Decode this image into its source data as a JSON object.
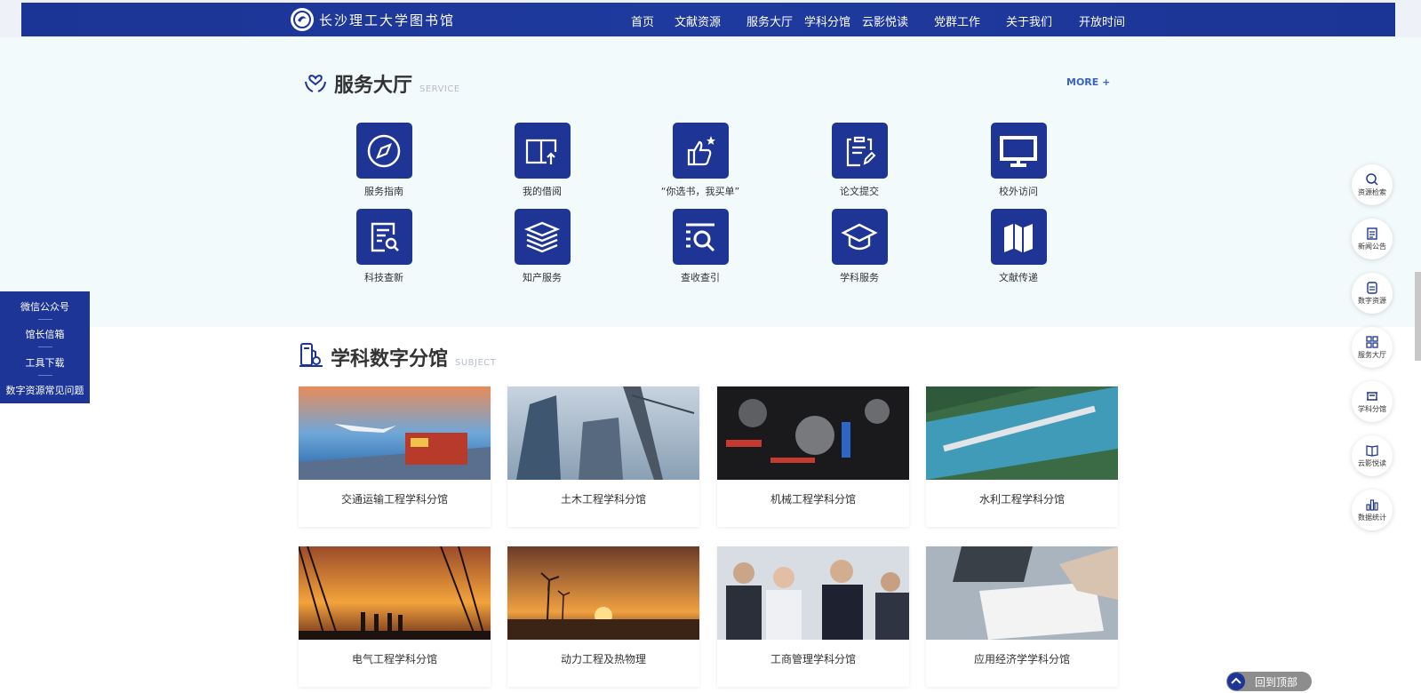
{
  "header": {
    "logo_text": "长沙理工大学图书馆",
    "nav": [
      {
        "label": "首页"
      },
      {
        "label": "文献资源"
      },
      {
        "label": "服务大厅"
      },
      {
        "label": "学科分馆"
      },
      {
        "label": "云影悦读"
      },
      {
        "label": "党群工作"
      },
      {
        "label": "关于我们"
      },
      {
        "label": "开放时间"
      }
    ]
  },
  "service": {
    "title": "服务大厅",
    "subtitle": "SERVICE",
    "more": "MORE +",
    "items": [
      {
        "label": "服务指南",
        "icon": "compass-icon"
      },
      {
        "label": "我的借阅",
        "icon": "book-return-icon"
      },
      {
        "label": "“你选书，我买单”",
        "icon": "thumbs-up-icon"
      },
      {
        "label": "论文提交",
        "icon": "clipboard-edit-icon"
      },
      {
        "label": "校外访问",
        "icon": "monitor-icon"
      },
      {
        "label": "科技查新",
        "icon": "document-search-icon"
      },
      {
        "label": "知产服务",
        "icon": "layers-icon"
      },
      {
        "label": "查收查引",
        "icon": "list-search-icon"
      },
      {
        "label": "学科服务",
        "icon": "graduation-cap-icon"
      },
      {
        "label": "文献传递",
        "icon": "map-icon"
      }
    ]
  },
  "subject": {
    "title": "学科数字分馆",
    "subtitle": "SUBJECT",
    "cards": [
      {
        "label": "交通运输工程学科分馆"
      },
      {
        "label": "土木工程学科分馆"
      },
      {
        "label": "机械工程学科分馆"
      },
      {
        "label": "水利工程学科分馆"
      },
      {
        "label": "电气工程学科分馆"
      },
      {
        "label": "动力工程及热物理"
      },
      {
        "label": "工商管理学科分馆"
      },
      {
        "label": "应用经济学学科分馆"
      }
    ]
  },
  "left_float": {
    "items": [
      {
        "label": "微信公众号"
      },
      {
        "label": "馆长信箱"
      },
      {
        "label": "工具下载"
      },
      {
        "label": "数字资源常见问题"
      }
    ]
  },
  "right_float": {
    "items": [
      {
        "label": "资源检索",
        "icon": "search-icon"
      },
      {
        "label": "新闻公告",
        "icon": "news-icon"
      },
      {
        "label": "数字资源",
        "icon": "database-icon"
      },
      {
        "label": "服务大厅",
        "icon": "grid-icon"
      },
      {
        "label": "学科分馆",
        "icon": "library-icon"
      },
      {
        "label": "云影悦读",
        "icon": "open-book-icon"
      },
      {
        "label": "数据统计",
        "icon": "bar-chart-icon"
      }
    ]
  },
  "back_to_top": "回到顶部",
  "colors": {
    "primary": "#1e3596",
    "accent": "#3a63c8",
    "service_bg": "#f2fafc"
  }
}
